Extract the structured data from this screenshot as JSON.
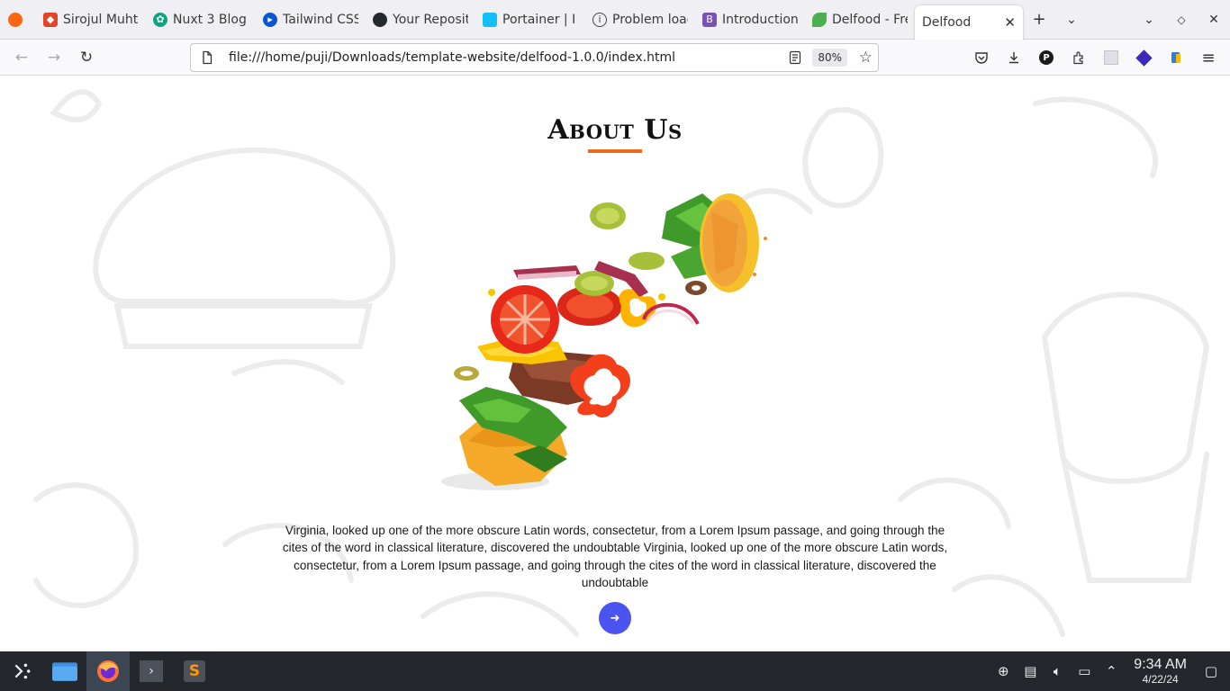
{
  "browser": {
    "tabs": [
      {
        "label": "",
        "icon": "firefox-view-icon",
        "color": "#ff6611"
      },
      {
        "label": "Sirojul Muhta",
        "icon": "gitlab-icon",
        "color": "#e24329"
      },
      {
        "label": "Nuxt 3 Blog",
        "icon": "chatgpt-icon",
        "color": "#10a37f"
      },
      {
        "label": "Tailwind CSS",
        "icon": "tailwind-icon",
        "color": "#0b57d0"
      },
      {
        "label": "Your Reposit",
        "icon": "github-icon",
        "color": "#24292f"
      },
      {
        "label": "Portainer | I",
        "icon": "portainer-icon",
        "color": "#13bef9"
      },
      {
        "label": "Problem load",
        "icon": "info-icon",
        "color": "#444444"
      },
      {
        "label": "Introduction",
        "icon": "bootstrap-icon",
        "color": "#7952b3"
      },
      {
        "label": "Delfood - Fre",
        "icon": "delfood-icon",
        "color": "#4caf50"
      },
      {
        "label": "Delfood",
        "icon": "",
        "color": "#ffffff"
      }
    ],
    "url": "file:///home/puji/Downloads/template-website/delfood-1.0.0/index.html",
    "zoom": "80%"
  },
  "page": {
    "title": "About Us",
    "body": "Virginia, looked up one of the more obscure Latin words, consectetur, from a Lorem Ipsum passage, and going through the cites of the word in classical literature, discovered the undoubtable Virginia, looked up one of the more obscure Latin words, consectetur, from a Lorem Ipsum passage, and going through the cites of the word in classical literature, discovered the undoubtable",
    "accent": "#ee6a1c",
    "button_color": "#4b53f0"
  },
  "taskbar": {
    "time": "9:34 AM",
    "date": "4/22/24"
  }
}
